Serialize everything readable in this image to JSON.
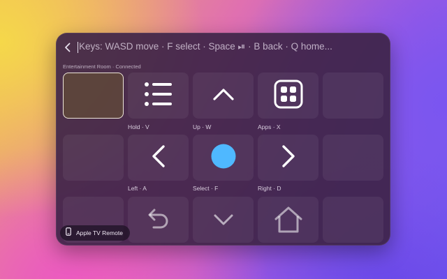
{
  "topbar": {
    "hint": "Keys: WASD move · F select · Space ⏯ · B back · Q home..."
  },
  "status": {
    "room": "Entertainment Room · Connected"
  },
  "tiles": {
    "hold": "Hold · V",
    "up": "Up · W",
    "apps": "Apps · X",
    "left": "Left · A",
    "select": "Select · F",
    "right": "Right · D"
  },
  "badge": {
    "label": "Apple TV Remote"
  },
  "colors": {
    "select_dot": "#4fb8ff",
    "icon": "#ffffff",
    "icon_dim": "rgba(255,255,255,0.55)"
  }
}
